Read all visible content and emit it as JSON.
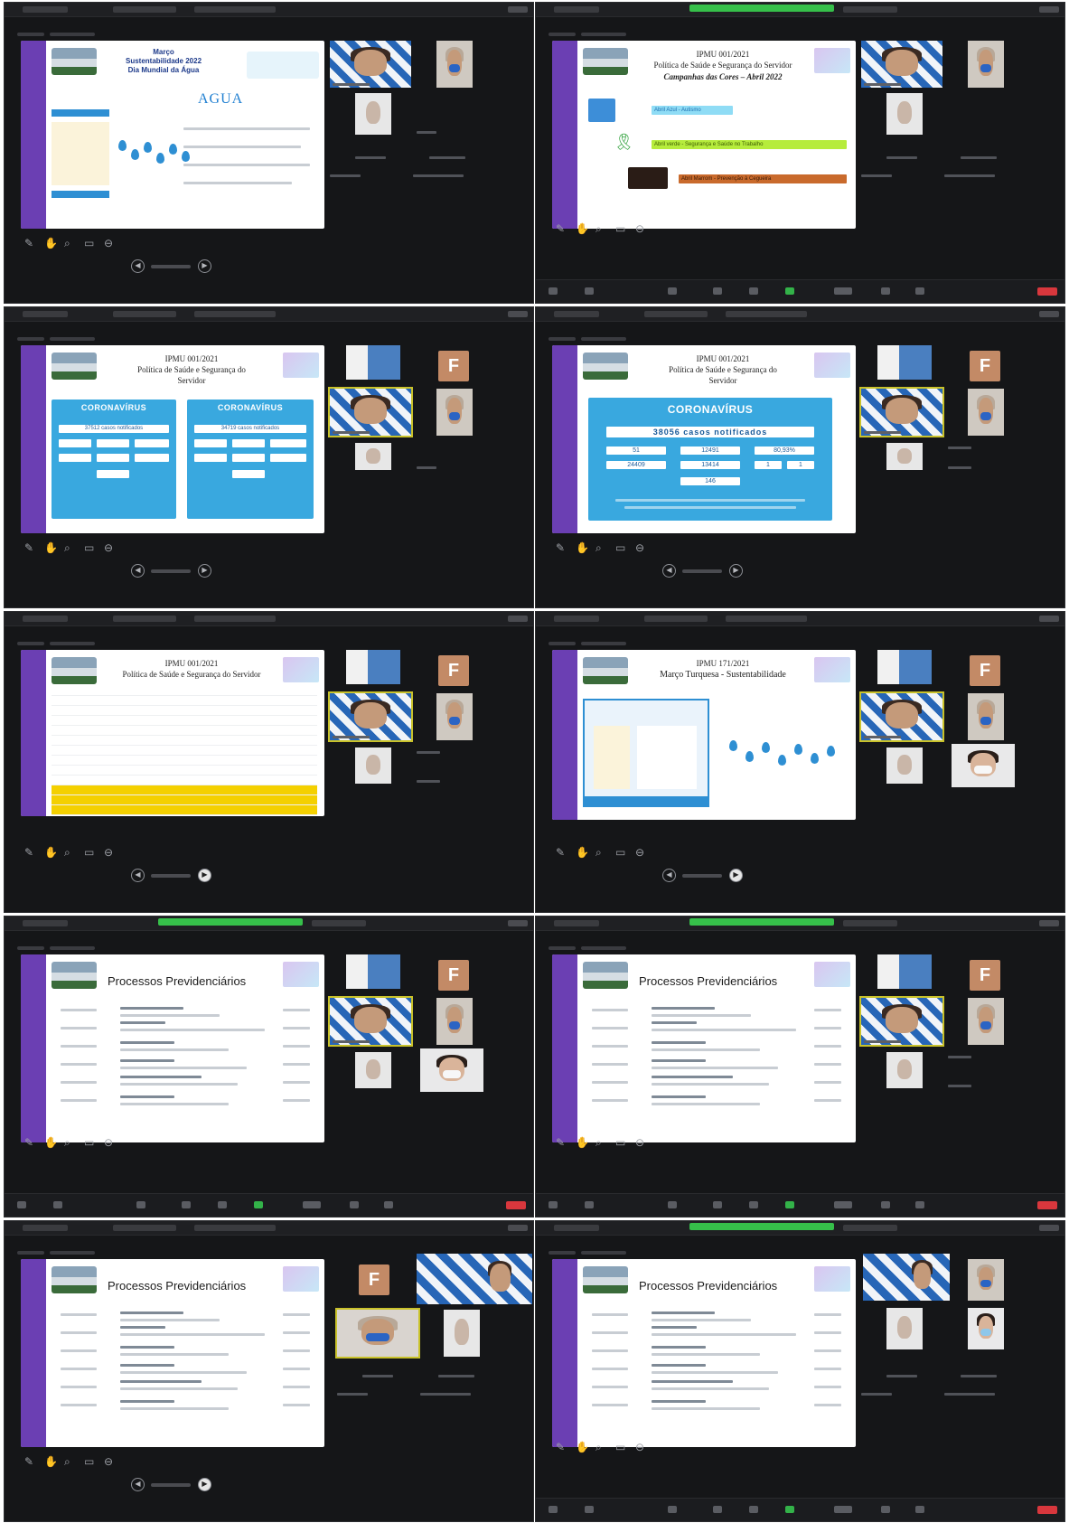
{
  "screens": [
    {
      "slide": {
        "kind": "water_day",
        "lines": [
          "Março",
          "Sustentabilidade 2022",
          "Dia Mundial da Água"
        ],
        "word": "AGUA"
      }
    },
    {
      "slide": {
        "kind": "colors_campaign",
        "lines": [
          "IPMU 001/2021",
          "Política de Saúde e Segurança do Servidor",
          "Campanhas das Cores – Abril 2022"
        ],
        "labels": [
          "Abril Azul - Autismo",
          "Abril verde - Segurança e Saúde no Trabalho",
          "Abril Marrom - Prevenção à Cegueira"
        ]
      }
    },
    {
      "slide": {
        "kind": "covid_double",
        "lines": [
          "IPMU 001/2021",
          "Política de Saúde e Segurança do",
          "Servidor"
        ],
        "box_title": "CORONAVÍRUS",
        "totals": [
          "37512 casos notificados",
          "34719 casos notificados"
        ]
      }
    },
    {
      "slide": {
        "kind": "covid_single",
        "lines": [
          "IPMU 001/2021",
          "Política de Saúde e Segurança do",
          "Servidor"
        ],
        "box_title": "CORONAVÍRUS",
        "total": "38056 casos notificados",
        "cells": [
          "51",
          "12491",
          "80,93%",
          "24409",
          "13414",
          "1",
          "1",
          "146"
        ]
      }
    },
    {
      "slide": {
        "kind": "table",
        "lines": [
          "IPMU 001/2021",
          "Política de Saúde e Segurança do Servidor"
        ]
      }
    },
    {
      "slide": {
        "kind": "water_turquoise",
        "lines": [
          "IPMU 171/2021",
          "Março Turquesa - Sustentabilidade"
        ]
      }
    },
    {
      "slide": {
        "kind": "processes",
        "title": "Processos Previdenciários"
      }
    },
    {
      "slide": {
        "kind": "processes",
        "title": "Processos Previdenciários"
      }
    },
    {
      "slide": {
        "kind": "processes",
        "title": "Processos Previdenciários"
      }
    },
    {
      "slide": {
        "kind": "processes",
        "title": "Processos Previdenciários"
      }
    }
  ],
  "avatar_letter": "F",
  "colors": {
    "app_bg": "#151618",
    "slide_wave": "#6b3fb3",
    "covid_blue": "#39a8df",
    "highlight_row": "#f4d000",
    "recording_green": "#36c04a",
    "leave_red": "#d8373d"
  }
}
